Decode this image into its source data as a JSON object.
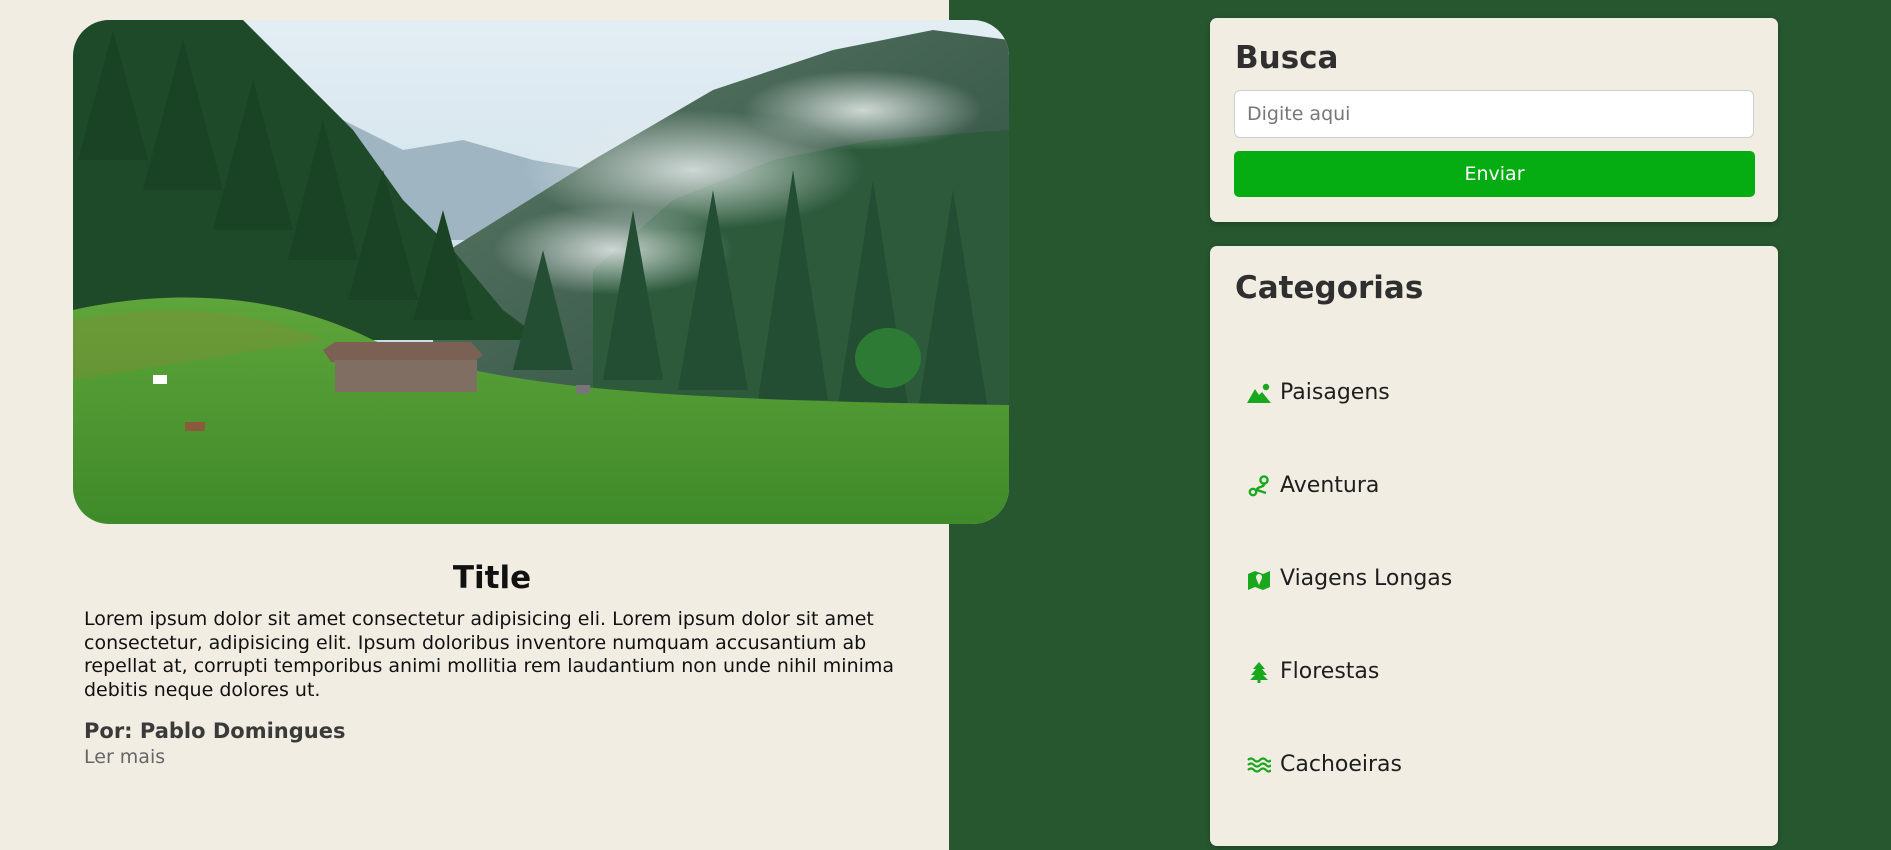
{
  "post": {
    "image_alt": "Mountain valley with misty pine forest and wooden cabin",
    "title": "Title",
    "text": "Lorem ipsum dolor sit amet consectetur adipisicing eli. Lorem ipsum dolor sit amet consectetur, adipisicing elit. Ipsum doloribus inventore numquam accusantium ab repellat at, corrupti temporibus animi mollitia rem laudantium non unde nihil minima debitis neque dolores ut.",
    "author": "Por: Pablo Domingues",
    "read_more": "Ler mais"
  },
  "search": {
    "title": "Busca",
    "placeholder": "Digite aqui",
    "value": "",
    "button_label": "Enviar"
  },
  "categories": {
    "title": "Categorias",
    "items": [
      {
        "label": "Paisagens",
        "icon": "mountain-sun-icon"
      },
      {
        "label": "Aventura",
        "icon": "route-icon"
      },
      {
        "label": "Viagens Longas",
        "icon": "map-location-icon"
      },
      {
        "label": "Florestas",
        "icon": "tree-icon"
      },
      {
        "label": "Cachoeiras",
        "icon": "water-icon"
      }
    ]
  },
  "colors": {
    "page_background": "#f2ede3",
    "sidebar_background": "#26572f",
    "accent_green": "#05ac12",
    "icon_green": "#19a81d"
  }
}
